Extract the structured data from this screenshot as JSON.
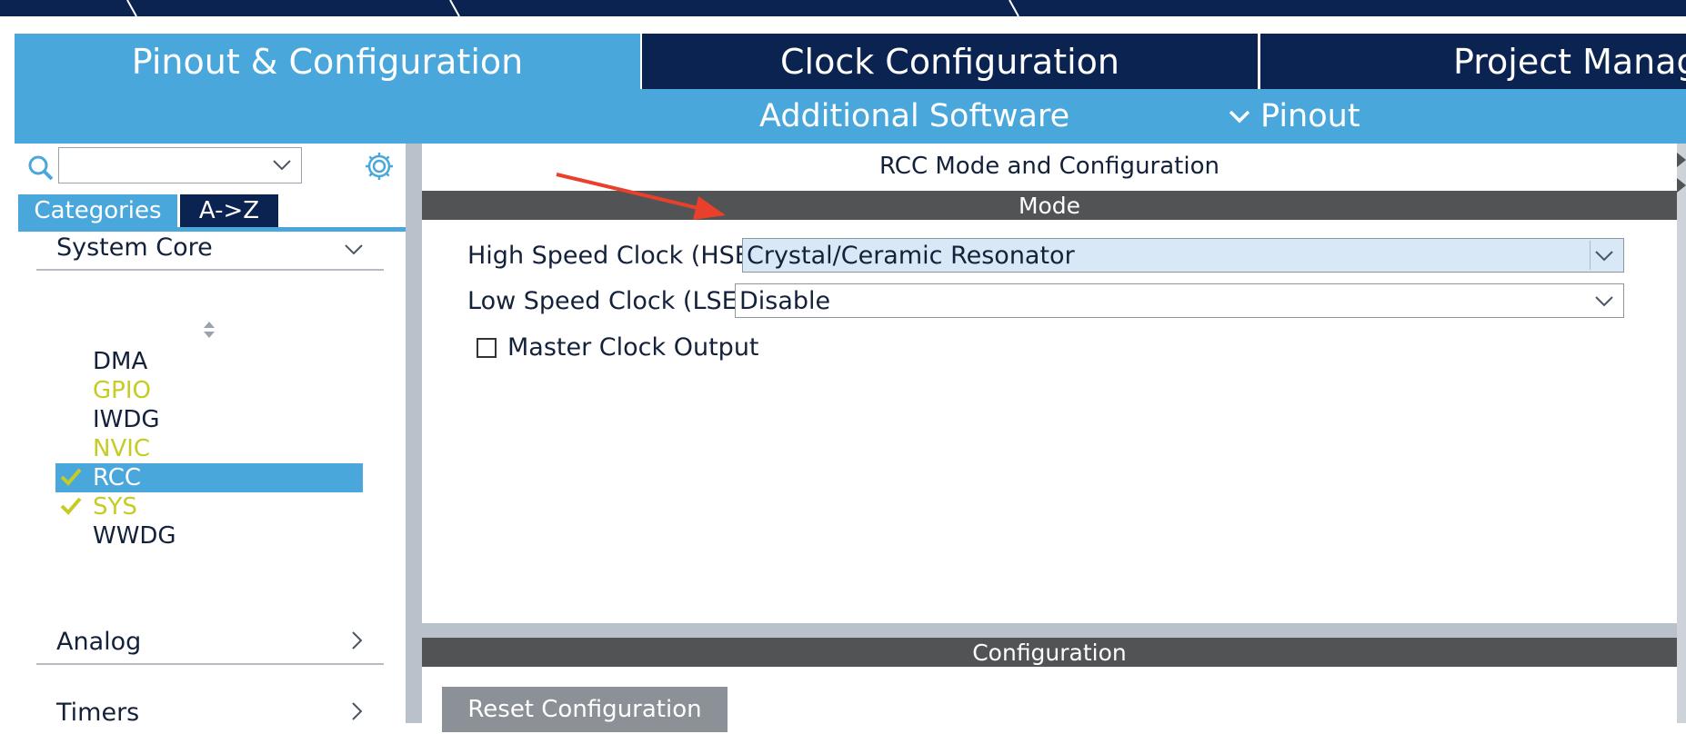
{
  "main_tabs": [
    {
      "label": "Pinout & Configuration",
      "active": true
    },
    {
      "label": "Clock Configuration",
      "active": false
    },
    {
      "label": "Project Manage",
      "active": false
    }
  ],
  "sub_tabs": {
    "additional_software": "Additional Software",
    "pinout": "Pinout"
  },
  "left_panel": {
    "search": {
      "value": "",
      "icon": "search-icon"
    },
    "settings_icon": "gear-icon",
    "view_tabs": {
      "categories": "Categories",
      "az": "A->Z"
    },
    "groups": [
      {
        "label": "System Core",
        "expanded": true
      },
      {
        "label": "Analog",
        "expanded": false
      },
      {
        "label": "Timers",
        "expanded": false
      }
    ],
    "system_core_items": [
      {
        "label": "DMA",
        "color": "#13213a",
        "checked": false,
        "selected": false
      },
      {
        "label": "GPIO",
        "color": "#c5cc22",
        "checked": false,
        "selected": false
      },
      {
        "label": "IWDG",
        "color": "#13213a",
        "checked": false,
        "selected": false
      },
      {
        "label": "NVIC",
        "color": "#c5cc22",
        "checked": false,
        "selected": false
      },
      {
        "label": "RCC",
        "color": "#ffffff",
        "checked": true,
        "selected": true
      },
      {
        "label": "SYS",
        "color": "#c5cc22",
        "checked": true,
        "selected": false
      },
      {
        "label": "WWDG",
        "color": "#13213a",
        "checked": false,
        "selected": false
      }
    ]
  },
  "right_panel": {
    "title": "RCC Mode and Configuration",
    "mode_header": "Mode",
    "hse": {
      "label": "High Speed Clock (HSE)",
      "value": "Crystal/Ceramic Resonator"
    },
    "lse": {
      "label": "Low Speed Clock (LSE)",
      "value": "Disable"
    },
    "master_clock_output": {
      "label": "Master Clock Output",
      "checked": false
    },
    "configuration_header": "Configuration",
    "reset_button": "Reset Configuration"
  },
  "colors": {
    "accent_blue": "#4aa7db",
    "navy": "#0a2350",
    "section_bar": "#515355",
    "annotation_arrow": "#e8402a",
    "lime_text": "#c5cc22"
  }
}
